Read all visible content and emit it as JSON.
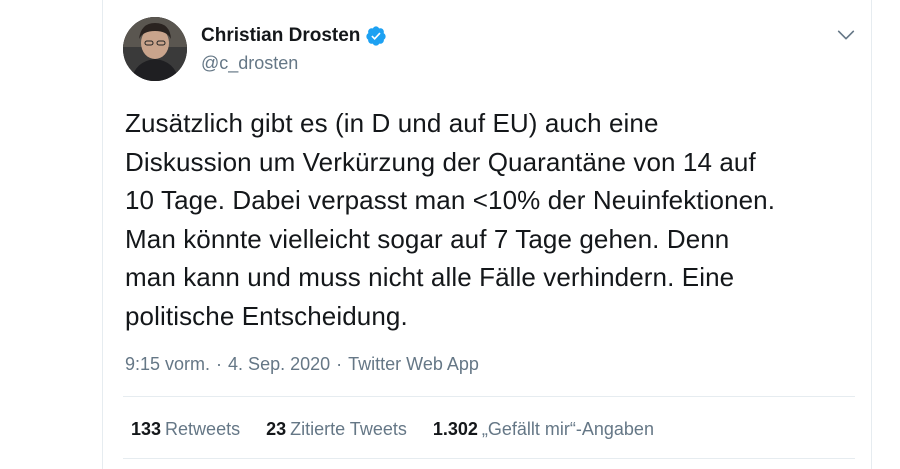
{
  "tweet": {
    "author": {
      "display_name": "Christian Drosten",
      "handle": "@c_drosten",
      "verified": true,
      "verified_color": "#1da1f2"
    },
    "text": "Zusätzlich gibt es (in D und auf EU) auch eine\nDiskussion um Verkürzung der Quarantäne von 14 auf\n10 Tage. Dabei verpasst man <10% der Neuinfektionen.\nMan könnte vielleicht sogar auf 7 Tage gehen. Denn\nman kann und muss nicht alle Fälle verhindern. Eine\npolitische Entscheidung.",
    "time": "9:15 vorm.",
    "date": "4. Sep. 2020",
    "separator": "·",
    "source": "Twitter Web App",
    "stats": {
      "retweets_count": "133",
      "retweets_label": "Retweets",
      "quotes_count": "23",
      "quotes_label": "Zitierte Tweets",
      "likes_count": "1.302",
      "likes_label": "„Gefällt mir“-Angaben"
    }
  },
  "icons": {
    "verified": "verified-badge-icon",
    "caret": "chevron-down-icon"
  }
}
